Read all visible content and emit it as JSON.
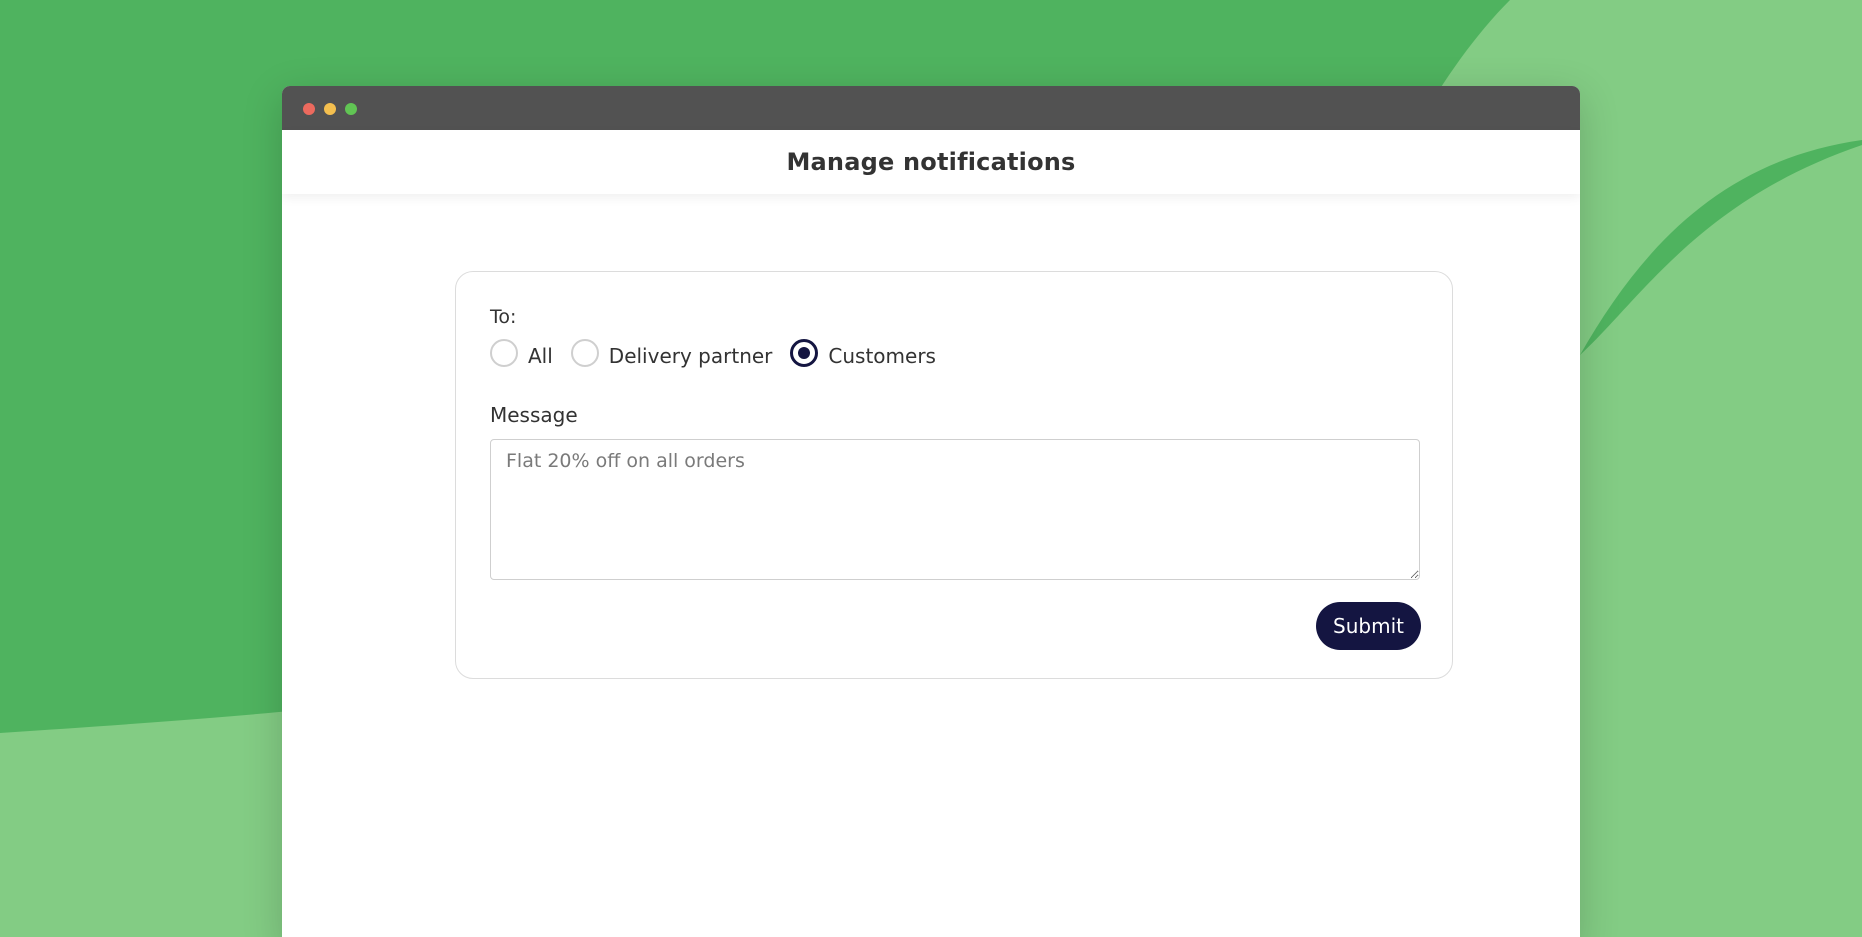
{
  "colors": {
    "background_green": "#4fb35f",
    "background_light_green": "#83cc84",
    "titlebar": "#525252",
    "primary": "#141541",
    "text": "#333333"
  },
  "window": {
    "controls": [
      "close",
      "minimize",
      "maximize"
    ]
  },
  "header": {
    "title": "Manage notifications"
  },
  "form": {
    "to_label": "To:",
    "recipients": [
      {
        "label": "All",
        "checked": false
      },
      {
        "label": "Delivery partner",
        "checked": false
      },
      {
        "label": "Customers",
        "checked": true
      }
    ],
    "message_label": "Message",
    "message_placeholder": "Flat 20% off on all orders",
    "message_value": "",
    "submit_label": "Submit"
  }
}
